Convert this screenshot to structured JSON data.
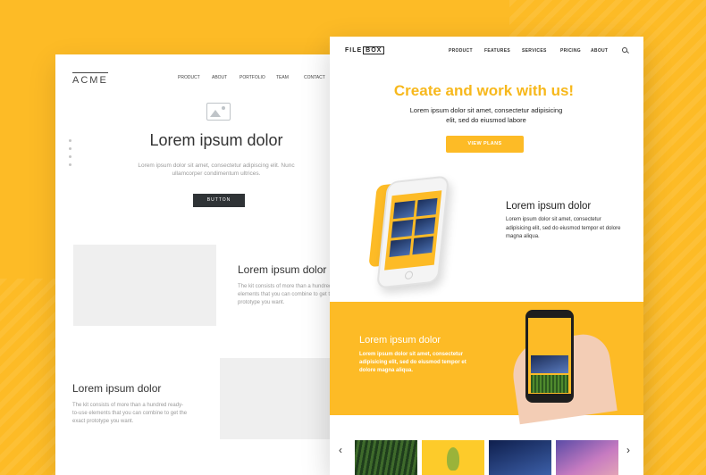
{
  "wireframe": {
    "logo": "ACME",
    "nav": [
      "PRODUCT",
      "ABOUT",
      "PORTFOLIO",
      "TEAM",
      "CONTACT"
    ],
    "hero_title": "Lorem ipsum dolor",
    "hero_sub": "Lorem ipsum dolor sit amet, consectetur adipiscing elit. Nunc ullamcorper condimentum ultrices.",
    "button": "BUTTON",
    "section1_title": "Lorem ipsum dolor",
    "section1_text": "The kit consists of more than a hundred ready-to-use elements that you can combine to get the exact prototype you want.",
    "section2_title": "Lorem ipsum dolor",
    "section2_text": "The kit consists of more than a hundred ready-to-use elements that you can combine to get the exact prototype you want."
  },
  "site": {
    "brand_a": "FILE",
    "brand_b": "BOX",
    "nav": [
      "PRODUCT",
      "FEATURES",
      "SERVICES",
      "PRICING",
      "ABOUT"
    ],
    "headline": "Create and work with us!",
    "lead": "Lorem ipsum dolor sit amet, consectetur adipisicing elit, sed do eiusmod labore",
    "cta": "VIEW PLANS",
    "feature_title": "Lorem ipsum dolor",
    "feature_text": "Lorem ipsum dolor sit amet, consectetur adipisicing elit, sed do eiusmod tempor et dolore magna aliqua.",
    "band_title": "Lorem ipsum dolor",
    "band_text": "Lorem ipsum dolor sit amet, consectetur adipisicing elit, sed do eiusmod tempor et dolore magna aliqua.",
    "gallery_prev": "‹",
    "gallery_next": "›"
  },
  "colors": {
    "background": "#FDBB26",
    "accent": "#F7B81C",
    "wire_button": "#2f3336"
  }
}
